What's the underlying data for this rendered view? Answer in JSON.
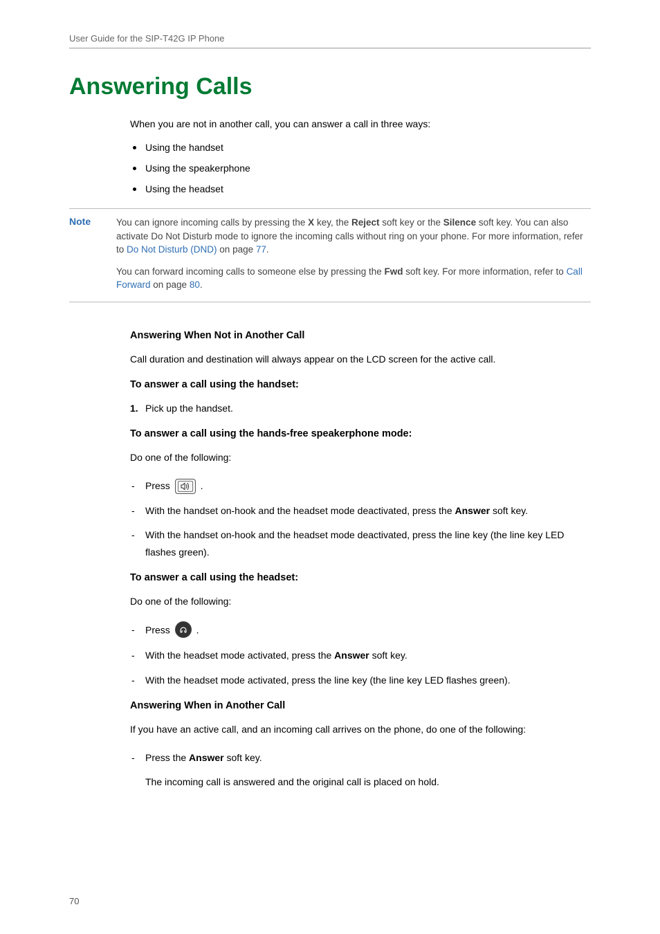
{
  "page": {
    "running_head": "User Guide for the SIP-T42G IP Phone",
    "page_number": "70"
  },
  "heading": "Answering Calls",
  "intro": "When you are not in another call, you can answer a call in three ways:",
  "ways": [
    "Using the handset",
    "Using the speakerphone",
    "Using the headset"
  ],
  "note": {
    "label": "Note",
    "p1_a": "You can ignore incoming calls by pressing the ",
    "p1_x": "X",
    "p1_b": " key, the ",
    "p1_reject": "Reject",
    "p1_c": " soft key or the ",
    "p1_silence": "Silence",
    "p1_d": " soft key. You can also activate Do Not Disturb mode to ignore the incoming calls without ring on your phone. For more information, refer to ",
    "p1_link": "Do Not Disturb (DND)",
    "p1_e": " on page ",
    "p1_page": "77",
    "p1_f": ".",
    "p2_a": "You can forward incoming calls to someone else by pressing the ",
    "p2_fwd": "Fwd",
    "p2_b": " soft key. For more information, refer to ",
    "p2_link": "Call Forward",
    "p2_c": " on page ",
    "p2_page": "80",
    "p2_d": "."
  },
  "section1": {
    "title": "Answering When Not in Another Call",
    "lead": "Call duration and destination will always appear on the LCD screen for the active call.",
    "handset_title": "To answer a call using the handset:",
    "handset_step1": "Pick up the handset.",
    "speaker_title": "To answer a call using the hands-free speakerphone mode:",
    "speaker_lead": "Do one of the following:",
    "speaker_item1_a": "Press ",
    "speaker_item1_b": " .",
    "speaker_item2_a": "With the handset on-hook and the headset mode deactivated, press the ",
    "speaker_item2_answer": "Answer",
    "speaker_item2_b": " soft key.",
    "speaker_item3": "With the handset on-hook and the headset mode deactivated, press the line key (the line key LED flashes green).",
    "headset_title": "To answer a call using the headset:",
    "headset_lead": "Do one of the following:",
    "headset_item1_a": "Press ",
    "headset_item1_b": " .",
    "headset_item2_a": "With the headset mode activated, press the ",
    "headset_item2_answer": "Answer",
    "headset_item2_b": " soft key.",
    "headset_item3": "With the headset mode activated, press the line key (the line key LED flashes green)."
  },
  "section2": {
    "title": "Answering When in Another Call",
    "lead": "If you have an active call, and an incoming call arrives on the phone, do one of the following:",
    "item1_a": "Press the ",
    "item1_answer": "Answer",
    "item1_b": " soft key.",
    "item1_result": "The incoming call is answered and the original call is placed on hold."
  },
  "icons": {
    "speaker": "speaker-icon",
    "headset": "headset-icon"
  }
}
